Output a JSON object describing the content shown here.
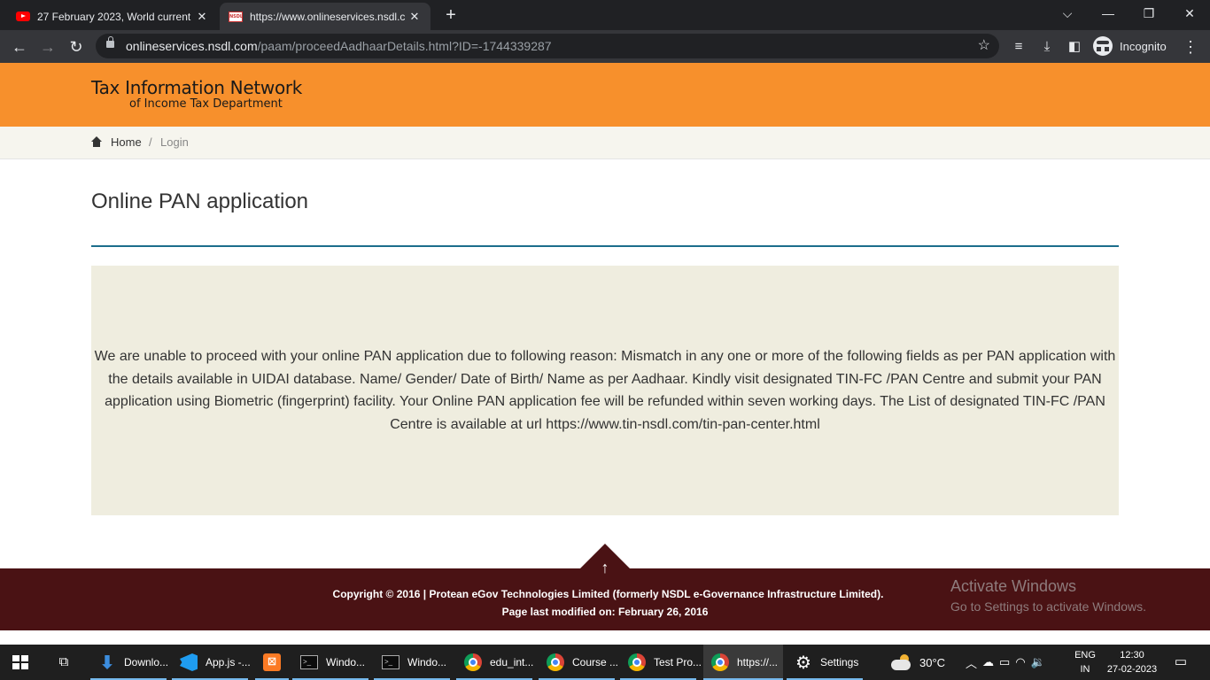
{
  "browser": {
    "tabs": [
      {
        "title": "27 February 2023, World current",
        "icon": "youtube-icon",
        "active": false
      },
      {
        "title": "https://www.onlineservices.nsdl.c",
        "icon": "nsdl-favicon",
        "active": true
      }
    ],
    "new_tab_symbol": "+",
    "url_host": "onlineservices.nsdl.com",
    "url_path": "/paam/proceedAadhaarDetails.html?ID=-1744339287",
    "profile_label": "Incognito"
  },
  "header": {
    "brand_line1": "Tax Information Network",
    "brand_line2": "of Income Tax Department",
    "color": "#f7902c"
  },
  "breadcrumb": {
    "home": "Home",
    "separator": "/",
    "current": "Login"
  },
  "main": {
    "title": "Online PAN application",
    "message": "We are unable to proceed with your online PAN application due to following reason: Mismatch in any one or more of the following fields as per PAN application with the details available in UIDAI database. Name/ Gender/ Date of Birth/ Name as per Aadhaar. Kindly visit designated TIN-FC /PAN Centre and submit your PAN application using Biometric (fingerprint) facility. Your Online PAN application fee will be refunded within seven working days. The List of designated TIN-FC /PAN Centre is available at url https://www.tin-nsdl.com/tin-pan-center.html"
  },
  "footer": {
    "copyright": "Copyright © 2016 | Protean eGov Technologies Limited (formerly NSDL e-Governance Infrastructure Limited).",
    "modified": "Page last modified on: February 26, 2016",
    "activate_title": "Activate Windows",
    "activate_sub": "Go to Settings to activate Windows.",
    "color": "#4a1214"
  },
  "taskbar": {
    "items": [
      {
        "label": "Downlo...",
        "icon": "downloads-icon"
      },
      {
        "label": "App.js -...",
        "icon": "vscode-icon"
      },
      {
        "label": "",
        "icon": "xampp-icon"
      },
      {
        "label": "Windo...",
        "icon": "terminal-icon"
      },
      {
        "label": "Windo...",
        "icon": "terminal-icon"
      },
      {
        "label": "edu_int...",
        "icon": "chrome-icon"
      },
      {
        "label": "Course ...",
        "icon": "chrome-icon"
      },
      {
        "label": "Test Pro...",
        "icon": "chrome-icon"
      },
      {
        "label": "https://...",
        "icon": "chrome-icon"
      },
      {
        "label": "Settings",
        "icon": "gear-icon"
      }
    ],
    "weather": "30°C",
    "lang1": "ENG",
    "lang2": "IN",
    "time": "12:30",
    "date": "27-02-2023"
  }
}
